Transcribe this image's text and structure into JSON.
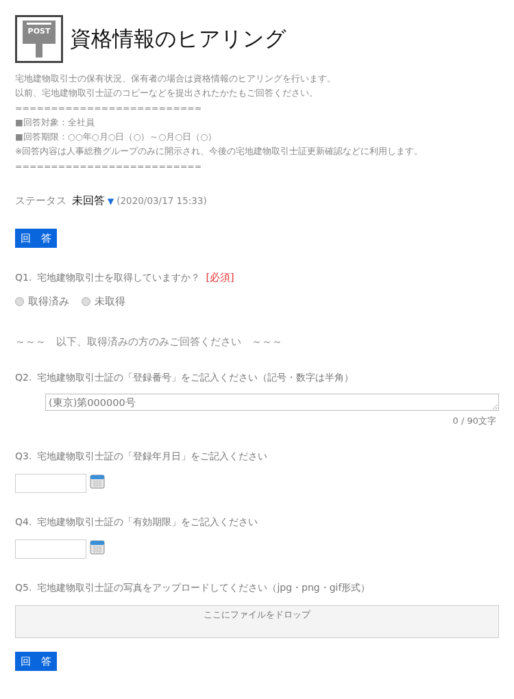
{
  "header": {
    "icon_label": "POST",
    "title": "資格情報のヒアリング"
  },
  "intro": [
    "宅地建物取引士の保有状況、保有者の場合は資格情報のヒアリングを行います。",
    "以前、宅地建物取引士証のコピーなどを提出されたかたもご回答ください。",
    "==========================",
    "■回答対象：全社員",
    "■回答期限：○○年○月○日（○）～○月○日（○）",
    "※回答内容は人事総務グループのみに開示され、今後の宅地建物取引士証更新確認などに利用します。",
    "=========================="
  ],
  "status": {
    "label": "ステータス",
    "value": "未回答",
    "caret": "▼",
    "timestamp": "(2020/03/17 15:33)"
  },
  "answer_button_top": "回　答",
  "questions": [
    {
      "kind": "radio",
      "number": "Q1.",
      "text": "宅地建物取引士を取得していますか？",
      "required": "[必須]",
      "options": [
        {
          "label": "取得済み",
          "selected": false
        },
        {
          "label": "未取得",
          "selected": false
        }
      ]
    },
    {
      "kind": "note",
      "text": "～～～　以下、取得済みの方のみご回答ください　～～～"
    },
    {
      "kind": "textarea",
      "number": "Q2.",
      "text": "宅地建物取引士証の「登録番号」をご記入ください（記号・数字は半角）",
      "placeholder": "(東京)第000000号",
      "counter": "0 / 90文字"
    },
    {
      "kind": "date",
      "number": "Q3.",
      "text": "宅地建物取引士証の「登録年月日」をご記入ください"
    },
    {
      "kind": "date",
      "number": "Q4.",
      "text": "宅地建物取引士証の「有効期限」をご記入ください"
    },
    {
      "kind": "file",
      "number": "Q5.",
      "text": "宅地建物取引士証の写真をアップロードしてください（jpg・png・gif形式）",
      "drop_label": "ここにファイルをドロップ"
    }
  ],
  "answer_button_bottom": "回　答"
}
